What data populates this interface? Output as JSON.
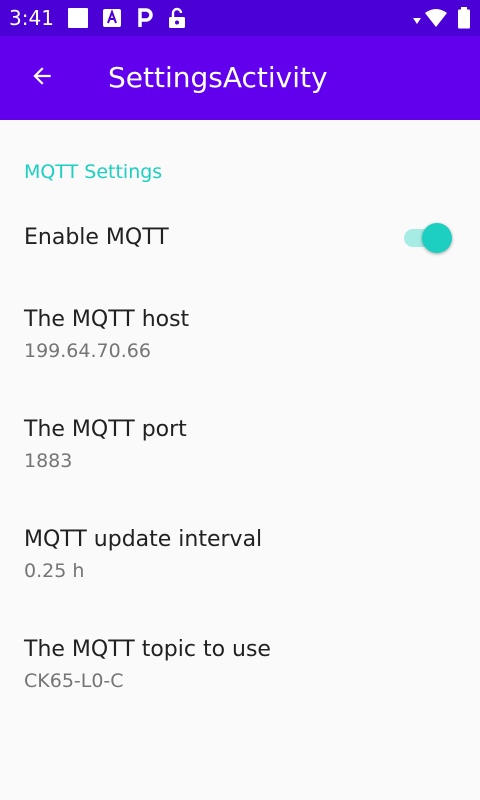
{
  "status_bar": {
    "time": "3:41",
    "icons": [
      "square-notification-icon",
      "font-a-icon",
      "parking-p-icon",
      "unlocked-padlock-icon",
      "signal-arrow-icon",
      "wifi-icon",
      "battery-icon"
    ]
  },
  "app_bar": {
    "back_icon": "arrow-back-icon",
    "title": "SettingsActivity"
  },
  "settings": {
    "category_title": "MQTT Settings",
    "enable": {
      "title": "Enable MQTT",
      "enabled": true
    },
    "items": [
      {
        "title": "The MQTT host",
        "summary": "199.64.70.66"
      },
      {
        "title": "The MQTT port",
        "summary": "1883"
      },
      {
        "title": "MQTT update interval",
        "summary": "0.25 h"
      },
      {
        "title": "The MQTT topic to use",
        "summary": "CK65-L0-C"
      }
    ]
  },
  "colors": {
    "status_bar": "#4b00d6",
    "app_bar": "#6200ee",
    "accent": "#1ccfc0",
    "switch_track": "#a6ece5"
  }
}
